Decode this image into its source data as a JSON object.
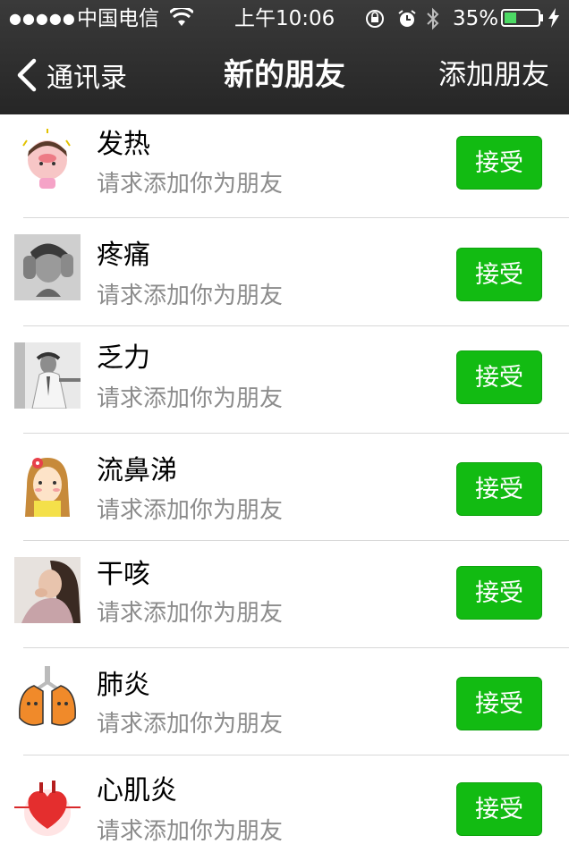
{
  "status_bar": {
    "signal_dots": "●●●●●",
    "carrier": "中国电信",
    "time": "上午10:06",
    "battery": "35%",
    "wifi_icon": "wifi-icon",
    "rotation_lock_icon": "rotation-lock-icon",
    "alarm_icon": "alarm-icon",
    "bluetooth_icon": "bluetooth-icon",
    "charging_icon": "bolt-icon"
  },
  "nav": {
    "back_label": "通讯录",
    "title": "新的朋友",
    "right_action": "添加朋友"
  },
  "accent_color": "#12bb12",
  "requests": [
    {
      "name": "发热",
      "subtitle": "请求添加你为朋友",
      "button": "接受",
      "avatar": "cartoon-feverish-girl"
    },
    {
      "name": "疼痛",
      "subtitle": "请求添加你为朋友",
      "button": "接受",
      "avatar": "photo-person-holding-head"
    },
    {
      "name": "乏力",
      "subtitle": "请求添加你为朋友",
      "button": "接受",
      "avatar": "photo-tired-man-at-desk"
    },
    {
      "name": "流鼻涕",
      "subtitle": "请求添加你为朋友",
      "button": "接受",
      "avatar": "cartoon-girl-flower"
    },
    {
      "name": "干咳",
      "subtitle": "请求添加你为朋友",
      "button": "接受",
      "avatar": "photo-woman-coughing"
    },
    {
      "name": "肺炎",
      "subtitle": "请求添加你为朋友",
      "button": "接受",
      "avatar": "cartoon-lungs"
    },
    {
      "name": "心肌炎",
      "subtitle": "请求添加你为朋友",
      "button": "接受",
      "avatar": "heart-with-ecg"
    }
  ]
}
